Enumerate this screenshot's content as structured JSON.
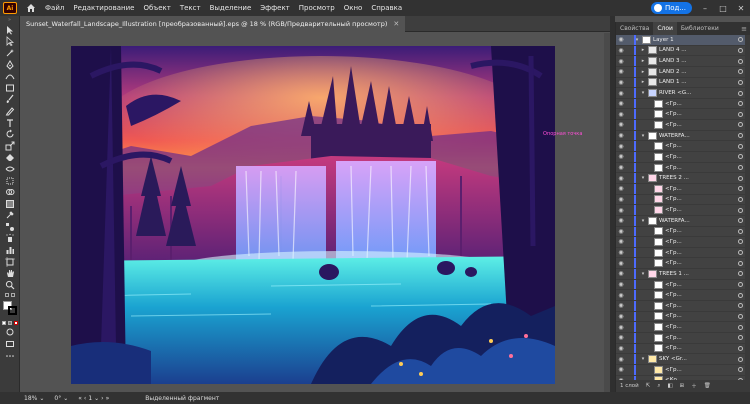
{
  "app": {
    "logo": "Ai"
  },
  "menu": [
    "Файл",
    "Редактирование",
    "Объект",
    "Текст",
    "Выделение",
    "Эффект",
    "Просмотр",
    "Окно",
    "Справка"
  ],
  "share_label": "Под...",
  "document_tab": "Sunset_Waterfall_Landscape_Illustration [преобразованный].eps @ 18 % (RGB/Предварительный просмотр)",
  "canvas_label": "Опорная точка",
  "panel": {
    "tabs": [
      "Свойства",
      "Слои",
      "Библиотеки"
    ],
    "active_tab": "Слои",
    "footer": "1 слой",
    "layers": [
      {
        "name": "Layer 1",
        "level": 0,
        "expanded": true,
        "selected": true
      },
      {
        "name": "LAND 4 ...",
        "level": 1,
        "expanded": false
      },
      {
        "name": "LAND 3 ...",
        "level": 1,
        "expanded": false
      },
      {
        "name": "LAND 2 ...",
        "level": 1,
        "expanded": false
      },
      {
        "name": "LAND 1 ...",
        "level": 1,
        "expanded": false
      },
      {
        "name": "RIVER <G...",
        "level": 1,
        "expanded": true
      },
      {
        "name": "<Гр...",
        "level": 2
      },
      {
        "name": "<Гр...",
        "level": 2
      },
      {
        "name": "<Гр...",
        "level": 2
      },
      {
        "name": "WATERFA...",
        "level": 1,
        "expanded": true
      },
      {
        "name": "<Гр...",
        "level": 2
      },
      {
        "name": "<Гр...",
        "level": 2
      },
      {
        "name": "<Гр...",
        "level": 2
      },
      {
        "name": "TREES 2 ...",
        "level": 1,
        "expanded": true
      },
      {
        "name": "<Гр...",
        "level": 2
      },
      {
        "name": "<Гр...",
        "level": 2
      },
      {
        "name": "<Гр...",
        "level": 2
      },
      {
        "name": "WATERFA...",
        "level": 1,
        "expanded": true
      },
      {
        "name": "<Гр...",
        "level": 2
      },
      {
        "name": "<Гр...",
        "level": 2
      },
      {
        "name": "<Гр...",
        "level": 2
      },
      {
        "name": "<Гр...",
        "level": 2
      },
      {
        "name": "TREES 1 ...",
        "level": 1,
        "expanded": true
      },
      {
        "name": "<Гр...",
        "level": 2
      },
      {
        "name": "<Гр...",
        "level": 2
      },
      {
        "name": "<Гр...",
        "level": 2
      },
      {
        "name": "<Гр...",
        "level": 2
      },
      {
        "name": "<Гр...",
        "level": 2
      },
      {
        "name": "<Гр...",
        "level": 2
      },
      {
        "name": "<Гр...",
        "level": 2
      },
      {
        "name": "SKY <Gr...",
        "level": 1,
        "expanded": true
      },
      {
        "name": "<Гр...",
        "level": 2
      },
      {
        "name": "<Ко...",
        "level": 2
      }
    ]
  },
  "status": {
    "zoom": "18%",
    "rotation": "0°",
    "artboard_number": "1",
    "tool_hint": "Выделенный фрагмент"
  },
  "colors": {
    "accent": "#1473e6",
    "layer_color": "#4d6bff"
  }
}
